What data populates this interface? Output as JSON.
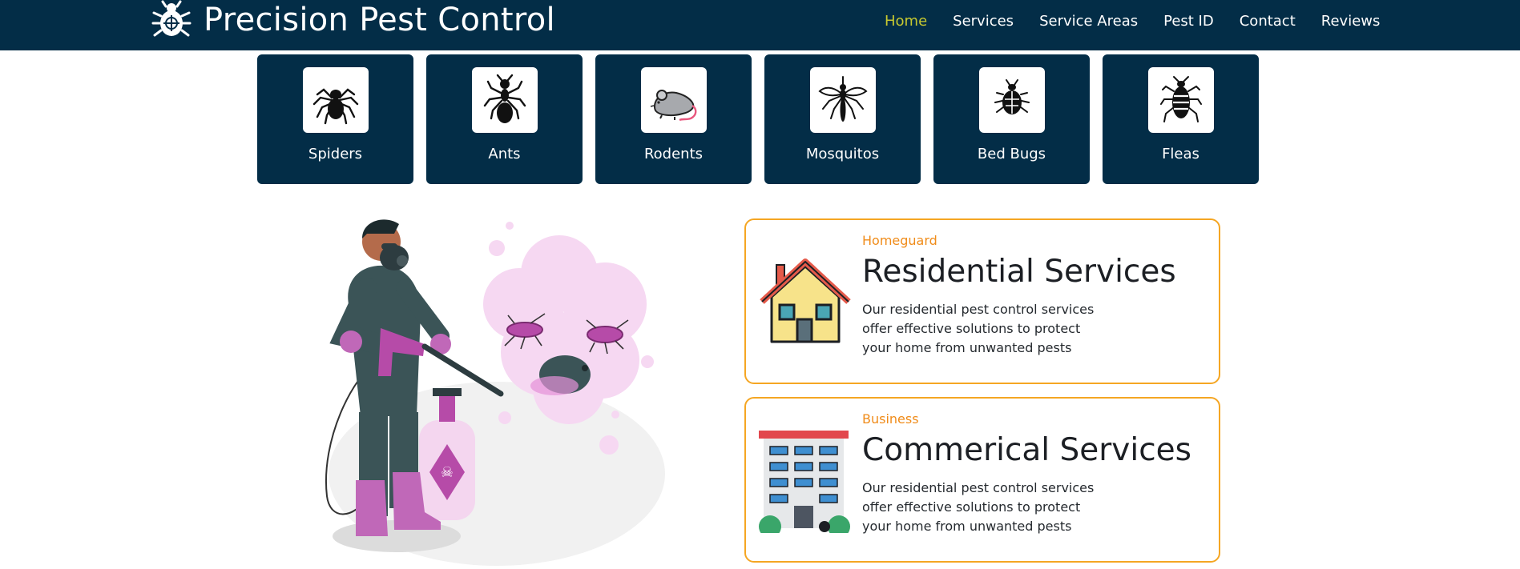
{
  "header": {
    "brand": "Precision Pest Control",
    "logo_icon": "bug-crosshair-icon",
    "nav": [
      {
        "label": "Home",
        "active": true
      },
      {
        "label": "Services",
        "active": false
      },
      {
        "label": "Service Areas",
        "active": false
      },
      {
        "label": "Pest ID",
        "active": false
      },
      {
        "label": "Contact",
        "active": false
      },
      {
        "label": "Reviews",
        "active": false
      }
    ]
  },
  "pests": [
    {
      "label": "Spiders",
      "icon": "spider-icon"
    },
    {
      "label": "Ants",
      "icon": "ant-icon"
    },
    {
      "label": "Rodents",
      "icon": "rat-icon"
    },
    {
      "label": "Mosquitos",
      "icon": "mosquito-icon"
    },
    {
      "label": "Bed Bugs",
      "icon": "bed-bug-icon"
    },
    {
      "label": "Fleas",
      "icon": "flea-icon"
    }
  ],
  "services": [
    {
      "kicker": "Homeguard",
      "title": "Residential Services",
      "description": "Our residential pest control services offer effective solutions to protect your home from unwanted pests",
      "icon": "house-icon"
    },
    {
      "kicker": "Business",
      "title": "Commerical Services",
      "description": "Our residential pest control services offer effective solutions to protect your home from unwanted pests",
      "icon": "office-building-icon"
    }
  ],
  "colors": {
    "header_bg": "#032d47",
    "nav_active": "#c7c930",
    "card_border": "#f5a623",
    "kicker": "#f08c1a"
  }
}
